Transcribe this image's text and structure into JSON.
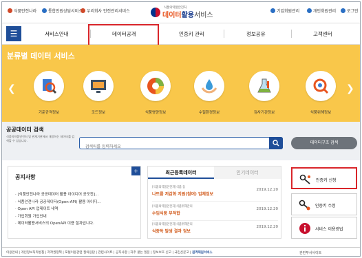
{
  "util_links": {
    "left": [
      "식품안전나라",
      "통합민원상담서비스",
      "우리회사 안전관리서비스"
    ],
    "right": [
      "기업회원관리",
      "개인회원관리",
      "로그인"
    ]
  },
  "logo": {
    "sub": "식품의약품안전처",
    "main_a": "데이터",
    "main_b": "활용",
    "main_c": "서비스"
  },
  "nav": {
    "items": [
      "서비스안내",
      "데이터공개",
      "인증키 관리",
      "정보공유",
      "고객센터"
    ]
  },
  "hero": {
    "title": "분류별 데이터 서비스",
    "services": [
      "기준규격정보",
      "코드정보",
      "식품영양정보",
      "수질환경정보",
      "검사기관정보",
      "식품위해정보"
    ]
  },
  "search": {
    "title": "공공데이터 검색",
    "desc": "식품의약품안전처 및 관계기관에서 개방하는 데이터를 검색할 수 있습니다.",
    "placeholder": "검색어를 입력하세요",
    "data_structure_button": "데이터구조 검색"
  },
  "notice": {
    "title": "공지사항",
    "items": [
      "· [식품안전나라 공공데이터 활용 아이디어 공모전]...",
      "· 식품안전나라 공공데이터(Open-API) 활용 아이디...",
      "· Open API 업데이트 내역",
      "· 가입회원 가입안내",
      "· 데이터활용서비스의 OpenAPI 이용 절차입니다."
    ]
  },
  "recent": {
    "tab_active": "최근등록데이터",
    "tab_inactive": "인기데이터",
    "items": [
      {
        "source": "[식품의약품안전처]식품 등",
        "title": "나트륨 저감화 지원(참여) 업체정보",
        "date": "2019.12.20"
      },
      {
        "source": "[식품의약품안전처]식품위해관리",
        "title": "수입식품 부적합",
        "date": "2019.12.20"
      },
      {
        "source": "[식품의약품안전처]식품위해관리",
        "title": "식중독 발생 결과 정보",
        "date": "2019.12.20"
      }
    ]
  },
  "right_buttons": [
    "인증키 신청",
    "인증키 수정",
    "서비스 이용방법"
  ],
  "footer": {
    "links": "이용안내 | 개인정보처리방침 | 저작권정책 | 포털이용관련 질의응답 | 관련사이트 | 공지사항 | 자주 묻는 질문 | 정보보호 신고 | 국민신문고 | ",
    "highlight": "원격제원서비스",
    "related": "관련부서사이트"
  },
  "colors": {
    "accent": "#1f4e99",
    "hero": "#f9c74a",
    "highlight_border": "#d9252a"
  }
}
